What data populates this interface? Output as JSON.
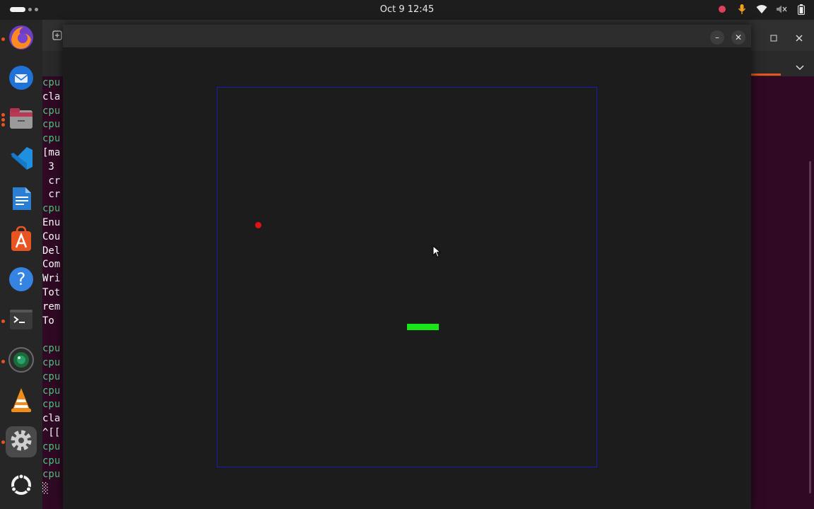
{
  "topbar": {
    "clock": "Oct 9  12:45",
    "tray_icons": [
      "record-icon",
      "microphone-icon",
      "wifi-icon",
      "volume-icon",
      "battery-icon"
    ]
  },
  "dock": {
    "items": [
      {
        "name": "firefox-icon",
        "running": true
      },
      {
        "name": "thunderbird-icon",
        "running": false
      },
      {
        "name": "files-icon",
        "running": true
      },
      {
        "name": "vscode-icon",
        "running": false
      },
      {
        "name": "libreoffice-writer-icon",
        "running": false
      },
      {
        "name": "app-center-icon",
        "running": false
      },
      {
        "name": "help-icon",
        "running": false
      },
      {
        "name": "terminal-icon",
        "running": true
      },
      {
        "name": "camera-app-icon",
        "running": true
      },
      {
        "name": "vlc-icon",
        "running": false
      },
      {
        "name": "settings-icon",
        "running": true,
        "active": true
      },
      {
        "name": "show-apps-icon",
        "running": false
      }
    ]
  },
  "terminal": {
    "lines": [
      {
        "text": "cpu",
        "color": "green"
      },
      {
        "text": "cla",
        "color": "white"
      },
      {
        "text": "cpu",
        "color": "green"
      },
      {
        "text": "cpu",
        "color": "green"
      },
      {
        "text": "cpu",
        "color": "green"
      },
      {
        "text": "[ma",
        "color": "white"
      },
      {
        "text": " 3 ",
        "color": "white"
      },
      {
        "text": " cr",
        "color": "white"
      },
      {
        "text": " cr",
        "color": "white"
      },
      {
        "text": "cpu",
        "color": "green"
      },
      {
        "text": "Enu",
        "color": "white"
      },
      {
        "text": "Cou",
        "color": "white"
      },
      {
        "text": "Del",
        "color": "white"
      },
      {
        "text": "Com",
        "color": "white"
      },
      {
        "text": "Wri",
        "color": "white"
      },
      {
        "text": "Tot",
        "color": "white"
      },
      {
        "text": "rem",
        "color": "white"
      },
      {
        "text": "To ",
        "color": "white"
      },
      {
        "text": "   ",
        "color": "white"
      },
      {
        "text": "cpu",
        "color": "green"
      },
      {
        "text": "cpu",
        "color": "green"
      },
      {
        "text": "cpu",
        "color": "green"
      },
      {
        "text": "cpu",
        "color": "green"
      },
      {
        "text": "cpu",
        "color": "green"
      },
      {
        "text": "cla",
        "color": "white"
      },
      {
        "text": "^[[",
        "color": "white"
      },
      {
        "text": "cpu",
        "color": "green"
      },
      {
        "text": "cpu",
        "color": "green"
      },
      {
        "text": "cpu",
        "color": "green"
      },
      {
        "text": "░",
        "color": "white"
      }
    ]
  },
  "game_window": {
    "minimize_label": "–",
    "close_label": "✕"
  },
  "game": {
    "ball_color": "#e01212",
    "paddle_color": "#18e618",
    "border_color": "#1a1ab4"
  },
  "colors": {
    "ubuntu_orange": "#e95420",
    "terminal_bg": "#300a24",
    "terminal_green": "#4ec47e"
  }
}
